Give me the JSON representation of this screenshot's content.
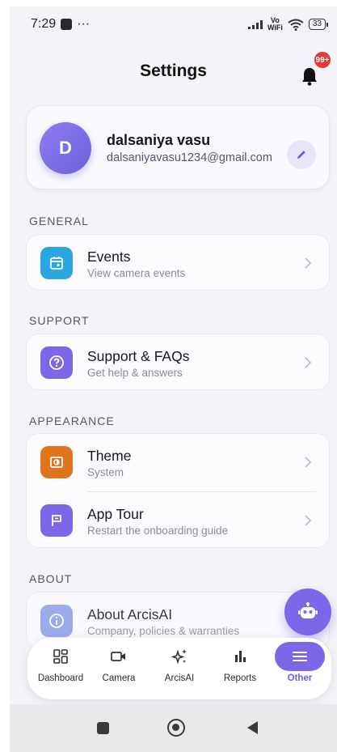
{
  "status_bar": {
    "time": "7:29",
    "more": "···",
    "vowifi_top": "Vo",
    "vowifi_bottom": "WiFi",
    "battery": "33"
  },
  "header": {
    "title": "Settings",
    "notification_badge": "99+"
  },
  "profile": {
    "initial": "D",
    "name": "dalsaniya vasu",
    "email": "dalsaniyavasu1234@gmail.com"
  },
  "sections": {
    "general": {
      "title": "GENERAL",
      "items": [
        {
          "title": "Events",
          "subtitle": "View camera events",
          "icon": "calendar-icon",
          "color": "#2aa7e0"
        }
      ]
    },
    "support": {
      "title": "SUPPORT",
      "items": [
        {
          "title": "Support & FAQs",
          "subtitle": "Get help & answers",
          "icon": "help-circle-icon",
          "color": "#7a68e8"
        }
      ]
    },
    "appearance": {
      "title": "APPEARANCE",
      "items": [
        {
          "title": "Theme",
          "subtitle": "System",
          "icon": "theme-icon",
          "color": "#e0741c"
        },
        {
          "title": "App Tour",
          "subtitle": "Restart the onboarding guide",
          "icon": "flag-icon",
          "color": "#7a68e8"
        }
      ]
    },
    "about": {
      "title": "ABOUT",
      "items": [
        {
          "title": "About ArcisAI",
          "subtitle": "Company, policies & warranties",
          "icon": "info-icon",
          "color": "#8f9de8"
        }
      ]
    }
  },
  "bottom_nav": {
    "items": [
      {
        "label": "Dashboard",
        "icon": "dashboard-icon"
      },
      {
        "label": "Camera",
        "icon": "video-camera-icon"
      },
      {
        "label": "ArcisAI",
        "icon": "sparkle-icon"
      },
      {
        "label": "Reports",
        "icon": "bar-chart-icon"
      },
      {
        "label": "Other",
        "icon": "menu-icon",
        "active": true
      }
    ]
  },
  "colors": {
    "accent": "#7a68e8",
    "badge": "#e53935",
    "background": "#f4f4f8"
  }
}
